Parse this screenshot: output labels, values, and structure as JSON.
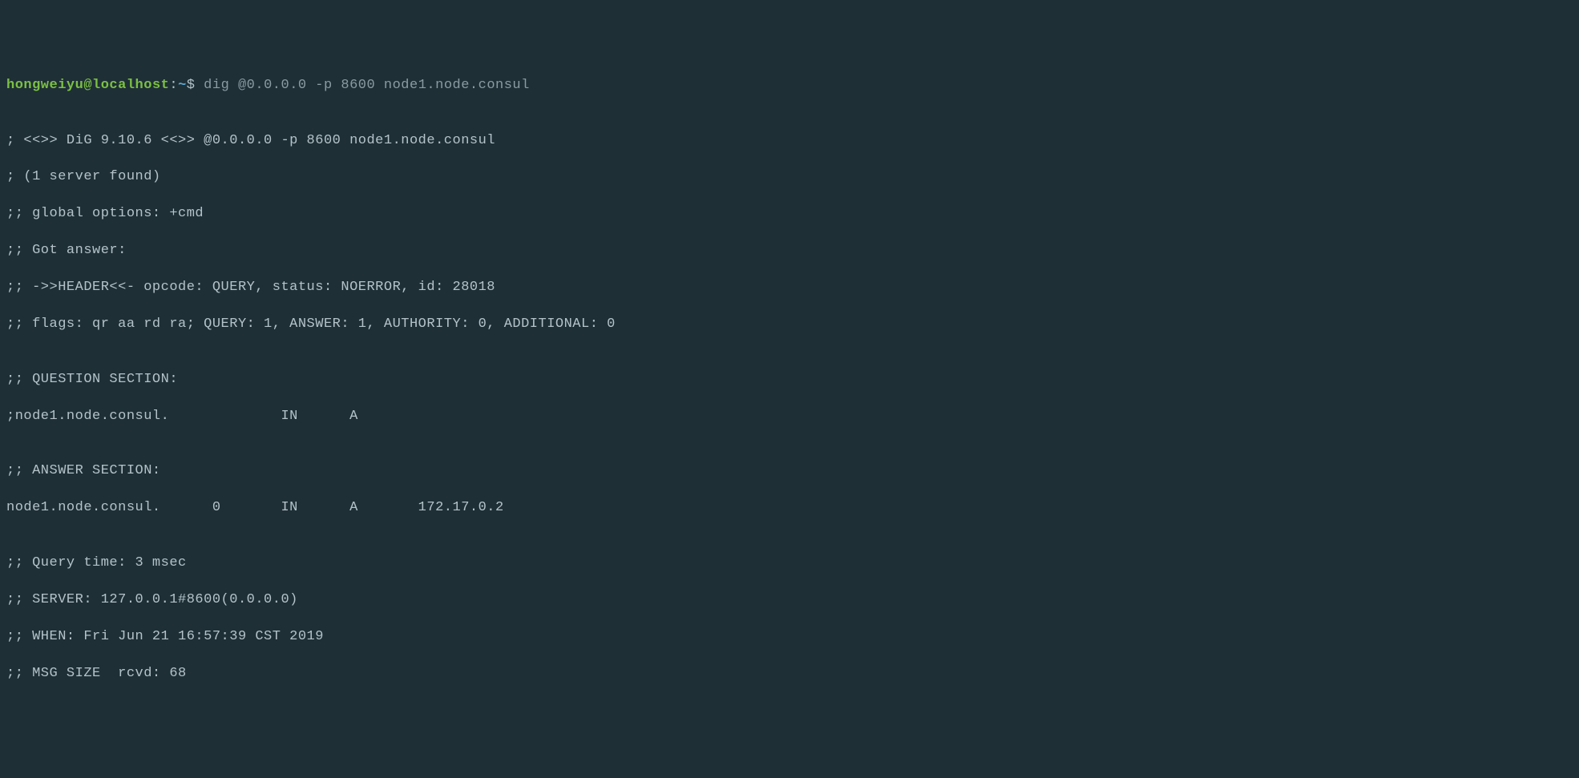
{
  "prompt": {
    "user": "hongweiyu",
    "at": "@",
    "host": "localhost",
    "colon": ":",
    "path": "~",
    "dollar": "$"
  },
  "command": "dig @0.0.0.0 -p 8600 node1.node.consul",
  "output": {
    "blank1": "",
    "header1": "; <<>> DiG 9.10.6 <<>> @0.0.0.0 -p 8600 node1.node.consul",
    "header2": "; (1 server found)",
    "header3": ";; global options: +cmd",
    "header4": ";; Got answer:",
    "header5": ";; ->>HEADER<<- opcode: QUERY, status: NOERROR, id: 28018",
    "header6": ";; flags: qr aa rd ra; QUERY: 1, ANSWER: 1, AUTHORITY: 0, ADDITIONAL: 0",
    "blank2": "",
    "question_header": ";; QUESTION SECTION:",
    "question_line": ";node1.node.consul.             IN      A",
    "blank3": "",
    "answer_header": ";; ANSWER SECTION:",
    "answer_line": "node1.node.consul.      0       IN      A       172.17.0.2",
    "blank4": "",
    "footer1": ";; Query time: 3 msec",
    "footer2": ";; SERVER: 127.0.0.1#8600(0.0.0.0)",
    "footer3": ";; WHEN: Fri Jun 21 16:57:39 CST 2019",
    "footer4": ";; MSG SIZE  rcvd: 68"
  }
}
